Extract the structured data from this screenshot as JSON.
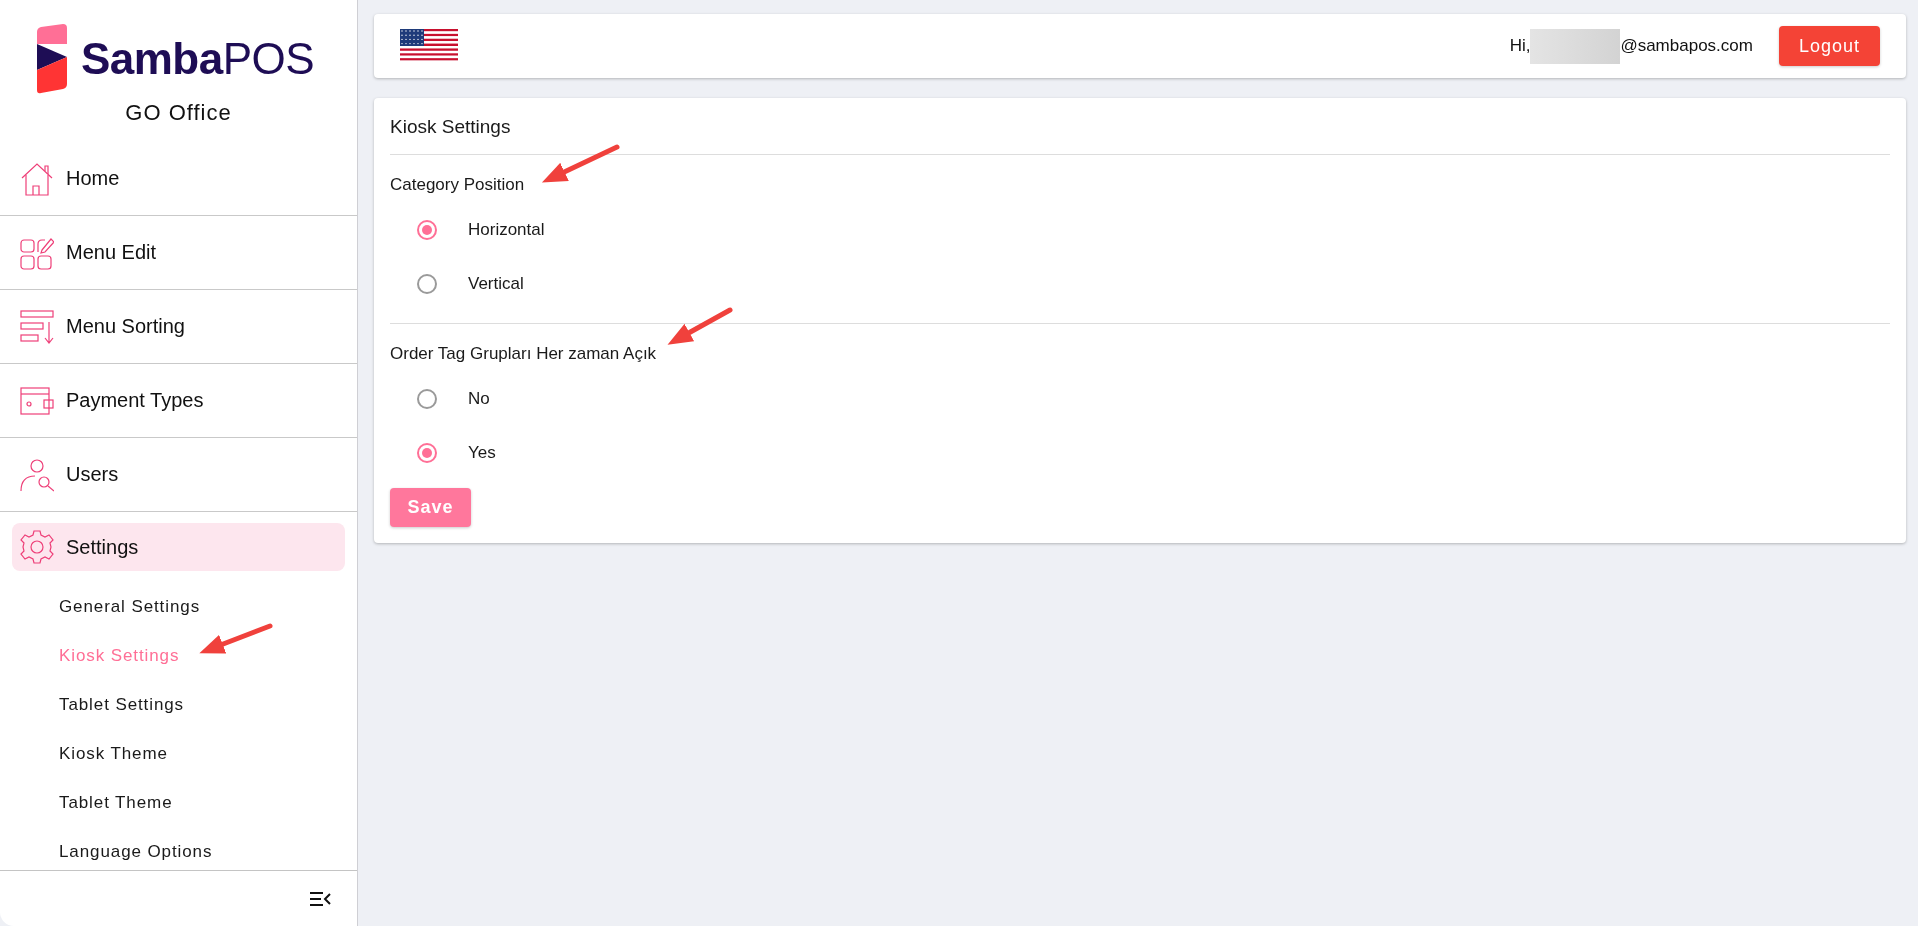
{
  "brand": {
    "name_bold": "Samba",
    "name_light": "POS",
    "subtitle": "GO Office"
  },
  "nav": [
    {
      "label": "Home",
      "selected": false
    },
    {
      "label": "Menu Edit",
      "selected": false
    },
    {
      "label": "Menu Sorting",
      "selected": false
    },
    {
      "label": "Payment Types",
      "selected": false
    },
    {
      "label": "Users",
      "selected": false
    },
    {
      "label": "Settings",
      "selected": true
    }
  ],
  "subnav": [
    {
      "label": "General Settings",
      "selected": false
    },
    {
      "label": "Kiosk Settings",
      "selected": true
    },
    {
      "label": "Tablet Settings",
      "selected": false
    },
    {
      "label": "Kiosk Theme",
      "selected": false
    },
    {
      "label": "Tablet Theme",
      "selected": false
    },
    {
      "label": "Language Options",
      "selected": false
    }
  ],
  "header": {
    "greeting": "Hi,",
    "email": "@sambapos.com",
    "logout": "Logout"
  },
  "card": {
    "title": "Kiosk Settings",
    "groups": [
      {
        "label": "Category Position",
        "options": [
          {
            "label": "Horizontal",
            "selected": true
          },
          {
            "label": "Vertical",
            "selected": false
          }
        ]
      },
      {
        "label": "Order Tag Grupları Her zaman Açık",
        "options": [
          {
            "label": "No",
            "selected": false
          },
          {
            "label": "Yes",
            "selected": true
          }
        ]
      }
    ],
    "save": "Save"
  }
}
